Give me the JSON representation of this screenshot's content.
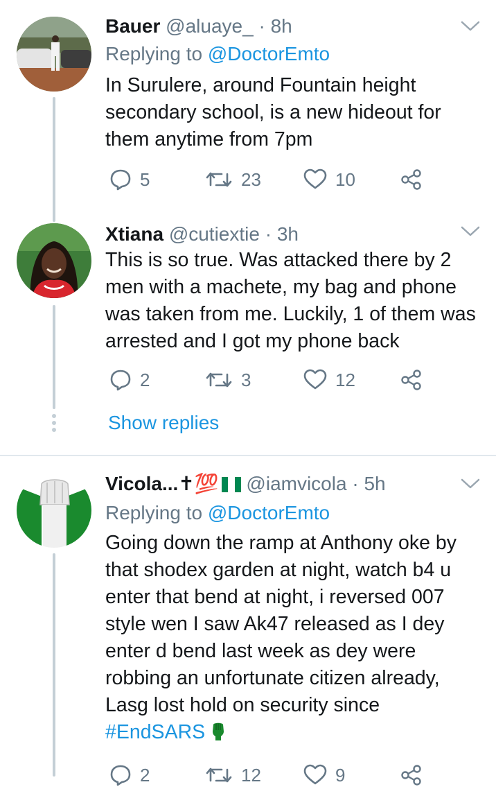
{
  "tweets": [
    {
      "name": "Bauer",
      "handle": "@aluaye_",
      "dot": "·",
      "time": "8h",
      "replying_prefix": "Replying to ",
      "replying_to": "@DoctorEmto",
      "text": "In Surulere, around Fountain height secondary school, is a new hideout for them anytime from 7pm",
      "replies": "5",
      "retweets": "23",
      "likes": "10"
    },
    {
      "name": "Xtiana",
      "handle": "@cutiextie",
      "dot": "·",
      "time": "3h",
      "text": "This is so true. Was attacked there by 2 men with a machete, my bag and phone was taken from me. Luckily, 1 of them was arrested and I got my phone back",
      "replies": "2",
      "retweets": "3",
      "likes": "12"
    },
    {
      "name": "Vicola...✝💯",
      "handle": "@iamvicola",
      "dot": "·",
      "time": "5h",
      "replying_prefix": "Replying to ",
      "replying_to": "@DoctorEmto",
      "text": "Going down the ramp at Anthony oke by that shodex garden at night, watch b4 u enter that bend at night, i reversed 007 style wen I saw Ak47 released as I dey enter d bend last week as dey were robbing an unfortunate citizen already, Lasg lost hold on security since",
      "hashtag": "#EndSARS",
      "replies": "2",
      "retweets": "12",
      "likes": "9"
    }
  ],
  "show_replies": "Show replies",
  "colors": {
    "link": "#1b95e0",
    "secondary": "#657786",
    "thread_line": "#c4cfd6",
    "nigeria_green": "#008751"
  },
  "icons": {
    "reply": "reply-icon",
    "retweet": "retweet-icon",
    "like": "heart-icon",
    "share": "share-icon",
    "caret": "chevron-down-icon",
    "flag": "nigeria-flag-icon",
    "fist": "raised-fist-icon"
  }
}
